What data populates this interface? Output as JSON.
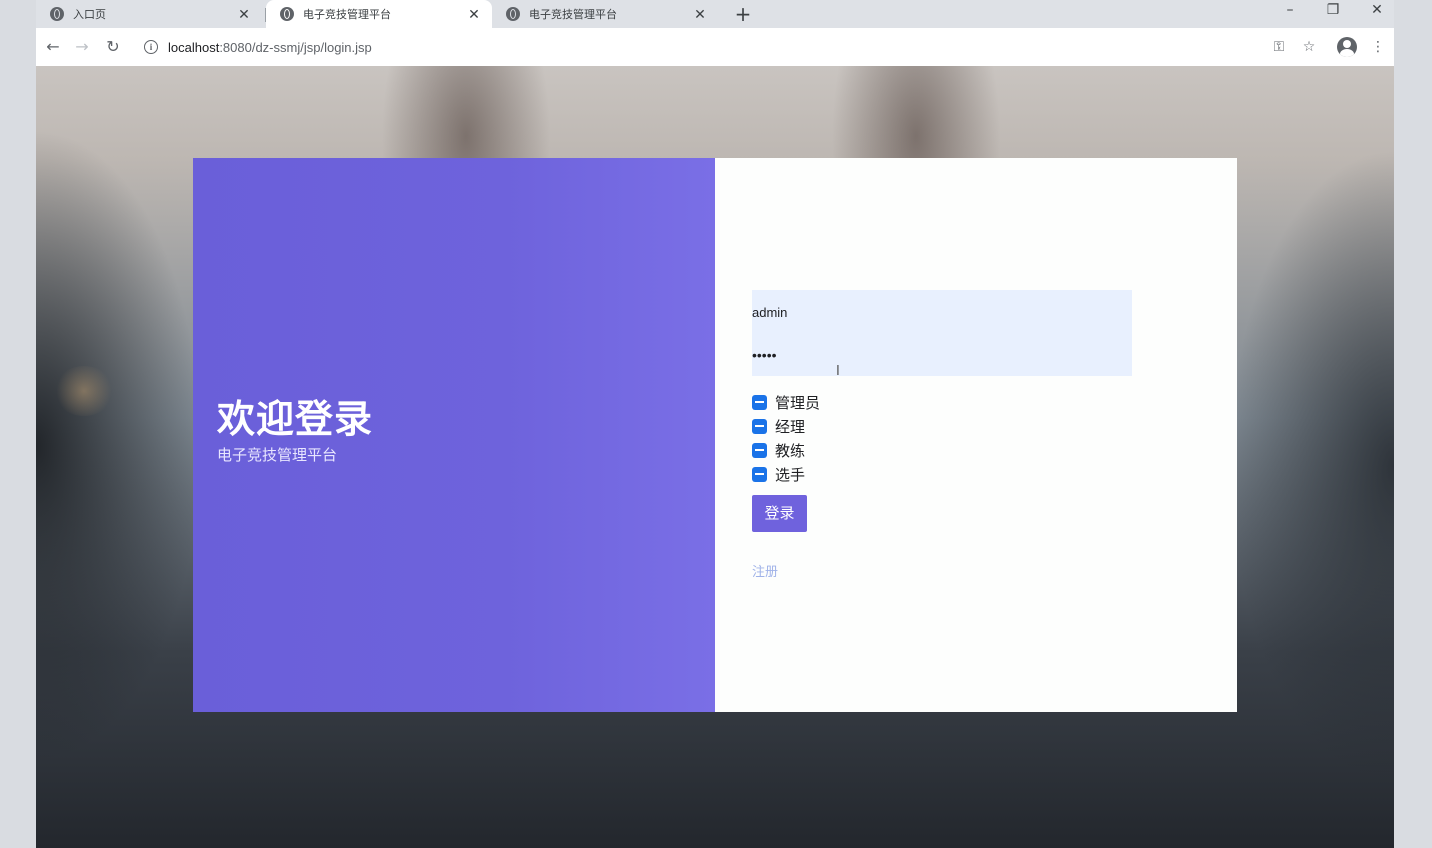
{
  "browser": {
    "tabs": [
      {
        "title": "入口页",
        "active": false
      },
      {
        "title": "电子竞技管理平台",
        "active": true
      },
      {
        "title": "电子竞技管理平台",
        "active": false
      }
    ],
    "url_host": "localhost",
    "url_path": ":8080/dz-ssmj/jsp/login.jsp"
  },
  "welcome": {
    "title": "欢迎登录",
    "subtitle": "电子竞技管理平台"
  },
  "form": {
    "username": "admin",
    "password": "•••••",
    "roles": [
      "管理员",
      "经理",
      "教练",
      "选手"
    ],
    "login_label": "登录",
    "register_label": "注册"
  },
  "colors": {
    "accent": "#6f62dd",
    "checkbox": "#1a73e8",
    "autofill": "#e8f0fe"
  }
}
